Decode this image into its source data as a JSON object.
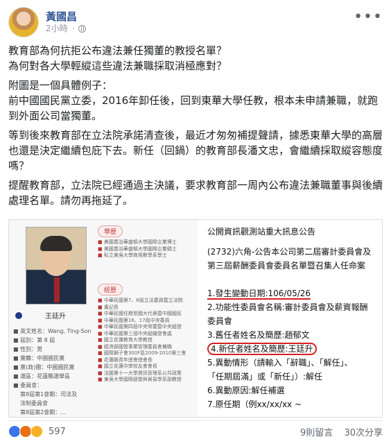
{
  "post": {
    "author": "黃國昌",
    "time": "2小時",
    "privacy_icon": "globe-icon",
    "more_icon": "more-options-icon",
    "paragraphs": [
      "教育部為何抗拒公布違法兼任獨董的教授名單？\n為何對各大學輕縱這些違法兼職採取消極應對？",
      "附圖是一個具體例子：\n前中國國民黨立委，2016年卸任後，回到東華大學任教，根本未申請兼職，就跑到外面公司當獨董。",
      "等到後來教育部在立法院承諾清查後，最近才匆匆補提聲請，據悉東華大學的高層也還是決定繼續包庇下去。新任（回鍋）的教育部長潘文忠，會繼續採取縱容態度嗎？",
      "提醒教育部，立法院已經通過主決議，要求教育部一周內公布違法兼職董事與後續處理名單。請勿再拖延了。"
    ]
  },
  "image": {
    "left": {
      "photo_caption": "王廷升",
      "badge_education": "學歷",
      "badge_experience": "經歷",
      "education": [
        "美國喬治華盛頓大學國際企業博士",
        "美國喬治華盛頓大學國際企業碩士",
        "私立東吳大學商用數學系學士"
      ],
      "experience": [
        "中華民國第7、8屆立法委員暨立法院",
        "書記長",
        "中華民國任務型國大代表暨中國國民",
        "中華民國第16、17屆中央委員",
        "中華民國第四屆中央常委暨中央組發",
        "中華民國第三屆中央組織發會處",
        "國立花蓮教育大學教授",
        "經濟部國營事業管理委員會兼職",
        "國際獅子會300F區2009-2010第三會",
        "花蓮縣青年總會總會長",
        "國立花蓮中學校友會會長",
        "法國第十一大學資訊管理系公共政策",
        "東吳大學國際經營與貿易學系副教授"
      ],
      "info": [
        "■ 英文姓名：Wang, Ting-Son",
        "■ 屆別：第 8 屆",
        "■ 性別：男",
        "■ 黨籍：中國國民黨",
        "■ 黨(政)團：中國國民黨",
        "■ 選區：花蓮縣選舉區",
        "■ 委員會：",
        "第8屆第1會期：司法及",
        "法制委員會",
        "第8屆第2會期：..."
      ]
    },
    "right": {
      "title": "公開資訊觀測站重大訊息公告",
      "lines": [
        "(2732)六角-公告本公司第二屆審計委員會及",
        "第三屆薪酬委員會委員名單暨召集人任命案",
        "",
        "1.發生變動日期:106/05/26",
        "2.功能性委員會名稱:審計委員會及薪資報酬",
        "委員會",
        "3.舊任者姓名及簡歷:趙郁文",
        "4.新任者姓名及簡歷:王廷升",
        "5.異動情形（請輸入「辭職」、「解任」、",
        "「任期屆滿」或「新任」）:解任",
        "6.異動原因:解任補選",
        "7.原任期（例xx/xx/xx ~"
      ]
    }
  },
  "footer": {
    "reaction_count": "597",
    "comments": "9則留言",
    "shares": "30次分享"
  }
}
